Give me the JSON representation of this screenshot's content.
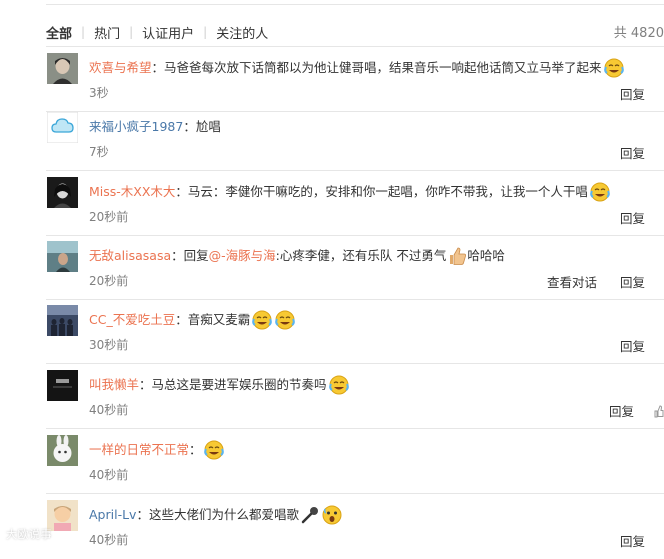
{
  "tabs": [
    "全部",
    "热门",
    "认证用户",
    "关注的人"
  ],
  "total_count": "共 4820",
  "reply_label": "回复",
  "conversation_label": "查看对话",
  "comments": [
    {
      "user": "欢喜与希望",
      "text": "：马爸爸每次放下话筒都以为他让健哥唱，结果音乐一响起他话筒又立马举了起来",
      "time": "3秒"
    },
    {
      "user": "来福小疯子1987",
      "text": "：尬唱",
      "time": "7秒"
    },
    {
      "user": "Miss-木XX木大",
      "text": "：马云：李健你干嘛吃的，安排和你一起唱，你咋不带我，让我一个人干唱",
      "time": "20秒前"
    },
    {
      "user": "无敌alisasasa",
      "text_prefix": "：回复",
      "mention": "@-海豚与海",
      "text": ":心疼李健，还有乐队 不过勇气",
      "text_suffix": "哈哈哈",
      "time": "20秒前"
    },
    {
      "user": "CC_不爱吃土豆",
      "text": "：音痴又麦霸",
      "time": "30秒前"
    },
    {
      "user": "叫我懒羊",
      "text": "：马总这是要进军娱乐圈的节奏吗",
      "time": "40秒前"
    },
    {
      "user": "一样的日常不正常",
      "text": "：",
      "time": "40秒前"
    },
    {
      "user": "April-Lv",
      "text": "：这些大佬们为什么都爱唱歌",
      "time": "40秒前"
    }
  ],
  "watermark": "大欧说事",
  "colors": {
    "username": "#eb7350",
    "username_alt": "#4a78a8",
    "muted": "#808080",
    "divider": "#e6e6e6"
  },
  "icons": [
    "laugh-cry-emoji",
    "thumbs-up-emoji",
    "microphone-emoji",
    "shocked-emoji",
    "thumbs-up-icon"
  ]
}
